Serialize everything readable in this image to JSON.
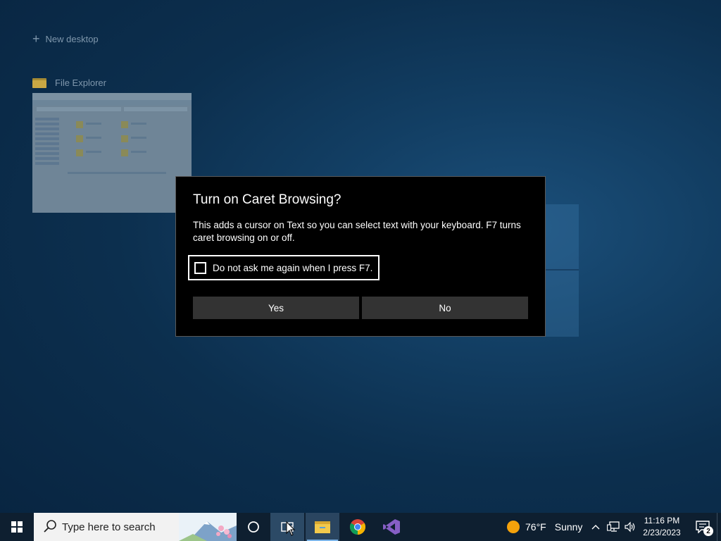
{
  "task_view": {
    "new_desktop_label": "New desktop",
    "window_title": "File Explorer"
  },
  "dialog": {
    "title": "Turn on Caret Browsing?",
    "body": "This adds a cursor on Text so you can select text with your keyboard. F7 turns caret browsing on or off.",
    "checkbox_label": "Do not ask me again when I press F7.",
    "checkbox_checked": false,
    "yes_label": "Yes",
    "no_label": "No"
  },
  "taskbar": {
    "search_placeholder": "Type here to search",
    "weather_temp": "76°F",
    "weather_condition": "Sunny",
    "clock_time": "11:16 PM",
    "clock_date": "2/23/2023",
    "notification_count": "2",
    "pinned_apps": [
      "cortana-icon",
      "task-view-icon",
      "file-explorer-icon",
      "chrome-icon",
      "visual-studio-icon"
    ]
  },
  "colors": {
    "accent": "#7cb5ea",
    "dialog_bg": "#000000",
    "button_bg": "#333333",
    "taskbar_bg": "#0e1f30"
  }
}
